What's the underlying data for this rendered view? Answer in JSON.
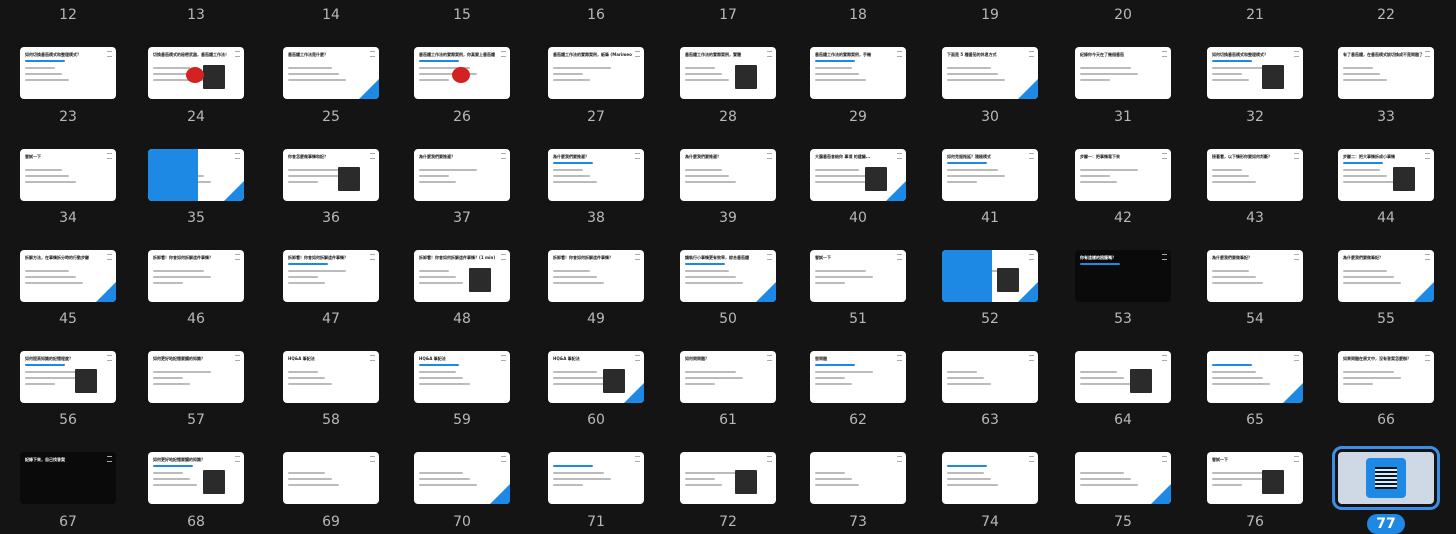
{
  "rows": [
    {
      "numbers": [
        "12",
        "13",
        "14",
        "15",
        "16",
        "17",
        "18",
        "19",
        "20",
        "21",
        "22"
      ]
    },
    {
      "numbers": [
        "23",
        "24",
        "25",
        "26",
        "27",
        "28",
        "29",
        "30",
        "31",
        "32",
        "33"
      ]
    },
    {
      "numbers": [
        "34",
        "35",
        "36",
        "37",
        "38",
        "39",
        "40",
        "41",
        "42",
        "43",
        "44"
      ]
    },
    {
      "numbers": [
        "45",
        "46",
        "47",
        "48",
        "49",
        "50",
        "51",
        "52",
        "53",
        "54",
        "55"
      ]
    },
    {
      "numbers": [
        "56",
        "57",
        "58",
        "59",
        "60",
        "61",
        "62",
        "63",
        "64",
        "65",
        "66"
      ]
    },
    {
      "numbers": [
        "67",
        "68",
        "69",
        "70",
        "71",
        "72",
        "73",
        "74",
        "75",
        "76",
        "77"
      ]
    }
  ],
  "slide_titles": [
    [
      "如何切換番茄模式和整理模式？",
      "切換番茄模式的秘密武器，番茄鐘工作法！",
      "番茄鐘工作法是什麼？",
      "番茄鐘工作法的實際案例，你真要上番茄鐘",
      "番茄鐘工作法的實際案例，紙筆 (Marimeo)",
      "番茄鐘工作法的實際案例，實體",
      "番茄鐘工作法的實際案例，手機",
      "下面是 5 種番茄的休息方式",
      "紀錄你今天在了幾個番茄",
      "如何切換番茄模式和整理模式？",
      "有了番茄鐘，在番茄模式該切換成不是問題了！"
    ],
    [
      "嘗試一下",
      "",
      "你會怎麼做事情和記？",
      "為什麼我們要推遲？",
      "為什麼我們要推遲？",
      "為什麼我們要推遲？",
      "大腦番茄會給你 事項 的建議...",
      "如何克服拖延？積極模式",
      "步驟一：把事情寫下來",
      "接著看，以下情形你要如何判斷？",
      "步驟二：把大事情拆成小事情"
    ],
    [
      "拆解方法，在事情拆分時的行動步驟",
      "拆卸看！你會如何拆解這件事情？",
      "拆卸看！你會如何拆解這件事情？",
      "拆卸看！你會如何拆解這件事情？(1 min)",
      "拆卸看！你會如何拆解這件事情？",
      "讓執行小事情更有效率，綜合番茄鐘",
      "嘗試一下",
      "",
      "你有這樣的困擾嗎？",
      "為什麼我們要做筆記？",
      "為什麼我們要做筆記？"
    ],
    [
      "如何提高知識的記憶程度？",
      "如何更好地記憶要讀的知識？",
      "HQ&A 筆記法",
      "HQ&A 筆記法",
      "HQ&A 筆記法",
      "如何問問題？",
      "發問題",
      "",
      "",
      "",
      "如果問題在原文中，沒有答案怎麼辦？"
    ],
    [
      "記錄下來，自己找答案",
      "如何更好地記憶要讀的知識？",
      "",
      "",
      "",
      "",
      "",
      "",
      "",
      "嘗試一下",
      ""
    ]
  ],
  "selected_slide": "77",
  "accent_color": "#1e88e5",
  "background_color": "#141414"
}
